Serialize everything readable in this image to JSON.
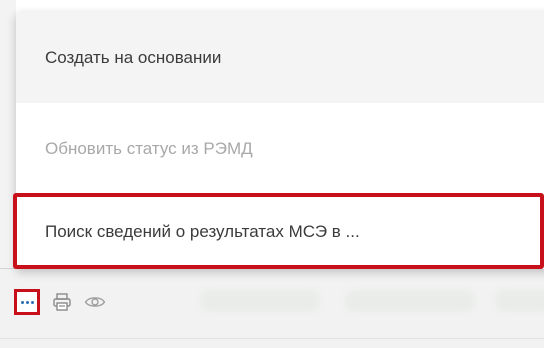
{
  "menu": {
    "items": [
      {
        "label": "Создать на основании",
        "state": "hover"
      },
      {
        "label": "Обновить статус из РЭМД",
        "state": "disabled"
      },
      {
        "label": "Поиск сведений о результатах МСЭ в ...",
        "state": "highlighted"
      }
    ]
  },
  "row_actions": {
    "icons": [
      "more-options-icon",
      "print-icon",
      "eye-icon"
    ]
  },
  "colors": {
    "highlight_frame": "#c8101a",
    "icon_blue": "#2d6fb3",
    "icon_gray": "#8a8a8a",
    "menu_hover_bg": "#f4f4f4",
    "disabled_text": "#a8a8a8"
  }
}
